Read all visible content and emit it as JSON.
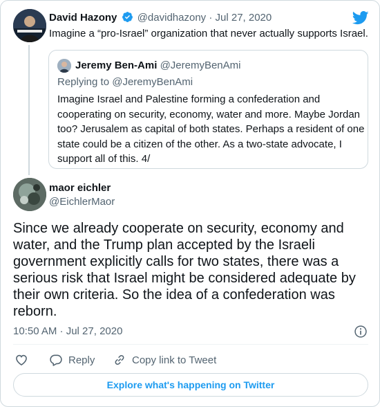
{
  "parent_tweet": {
    "author_name": "David Hazony",
    "handle": "@davidhazony",
    "separator": "·",
    "date": "Jul 27, 2020",
    "text": "Imagine a “pro-Israel” organization that never actually supports Israel.",
    "verified": true
  },
  "quoted_tweet": {
    "author_name": "Jeremy Ben-Ami",
    "handle": "@JeremyBenAmi",
    "replying_to": "Replying to @JeremyBenAmi",
    "text": "Imagine Israel and Palestine forming a confederation and cooperating on security, economy, water and more. Maybe Jordan too? Jerusalem as capital of both states. Perhaps a resident of one state could be a citizen of the other. As a two-state advocate, I support all of this. 4/"
  },
  "main_tweet": {
    "author_name": "maor eichler",
    "handle": "@EichlerMaor",
    "text": "Since we already cooperate on security, economy and water, and the Trump plan accepted by the Israeli government explicitly calls for two states, there was a serious risk that Israel might be considered adequate by their own criteria. So the idea of a confederation was reborn.",
    "timestamp": "10:50 AM · Jul 27, 2020"
  },
  "actions": {
    "like_icon": "heart-icon",
    "reply_label": "Reply",
    "copy_link_label": "Copy link to Tweet"
  },
  "explore_label": "Explore what's happening on Twitter",
  "colors": {
    "brand_blue": "#1d9bf0",
    "text": "#0f1419",
    "secondary_text": "#536471",
    "border": "#cfd9de"
  }
}
